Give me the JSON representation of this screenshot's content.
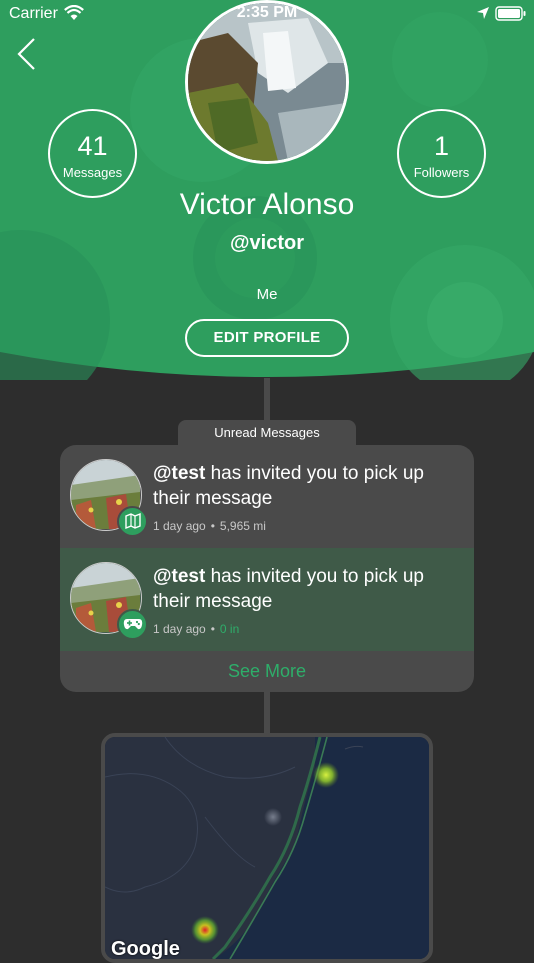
{
  "status_bar": {
    "carrier": "Carrier",
    "time": "2:35 PM"
  },
  "profile": {
    "name": "Victor Alonso",
    "username": "@victor",
    "bio": "Me",
    "edit_label": "EDIT PROFILE",
    "stats": [
      {
        "value": "41",
        "label": "Messages"
      },
      {
        "value": "1",
        "label": "Followers"
      }
    ]
  },
  "unread": {
    "tab_label": "Unread Messages",
    "items": [
      {
        "user": "@test",
        "text": " has invited you to pick up their message",
        "time": "1 day ago",
        "distance": "5,965 mi",
        "badge_icon": "map-icon"
      },
      {
        "user": "@test",
        "text": " has invited you to pick up their message",
        "time": "1 day ago",
        "distance": "0 in",
        "badge_icon": "gamepad-icon"
      }
    ],
    "see_more": "See More"
  },
  "map": {
    "attribution": "Google"
  },
  "colors": {
    "header": "#2e9e5e",
    "accent": "#2eae6a",
    "background": "#2d2d2d",
    "card": "#4a4a4a"
  }
}
